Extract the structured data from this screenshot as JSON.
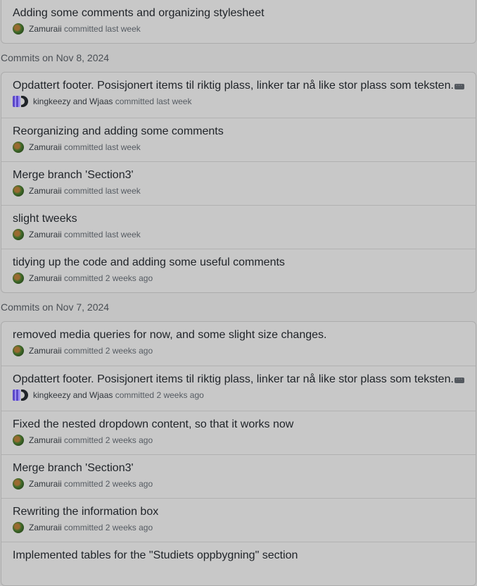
{
  "top_commit": {
    "title": "Adding some comments and organizing stylesheet",
    "author": "Zamuraii",
    "action": "committed",
    "time": "last week"
  },
  "groups": [
    {
      "header": "Commits on Nov 8, 2024",
      "commits": [
        {
          "title": "Opdattert footer. Posisjonert items til riktig plass, linker tar nå like stor plass som teksten.",
          "author": "kingkeezy and Wjaas",
          "action": "committed",
          "time": "last week",
          "pair": true,
          "ellipsis": "···"
        },
        {
          "title": "Reorganizing and adding some comments",
          "author": "Zamuraii",
          "action": "committed",
          "time": "last week"
        },
        {
          "title": "Merge branch 'Section3'",
          "author": "Zamuraii",
          "action": "committed",
          "time": "last week"
        },
        {
          "title": "slight tweeks",
          "author": "Zamuraii",
          "action": "committed",
          "time": "last week"
        },
        {
          "title": "tidying up the code and adding some useful comments",
          "author": "Zamuraii",
          "action": "committed",
          "time": "2 weeks ago"
        }
      ]
    },
    {
      "header": "Commits on Nov 7, 2024",
      "commits": [
        {
          "title": "removed media queries for now, and some slight size changes.",
          "author": "Zamuraii",
          "action": "committed",
          "time": "2 weeks ago"
        },
        {
          "title": "Opdattert footer. Posisjonert items til riktig plass, linker tar nå like stor plass som teksten.",
          "author": "kingkeezy and Wjaas",
          "action": "committed",
          "time": "2 weeks ago",
          "pair": true,
          "ellipsis": "···"
        },
        {
          "title": "Fixed the nested dropdown content, so that it works now",
          "author": "Zamuraii",
          "action": "committed",
          "time": "2 weeks ago"
        },
        {
          "title": "Merge branch 'Section3'",
          "author": "Zamuraii",
          "action": "committed",
          "time": "2 weeks ago"
        },
        {
          "title": "Rewriting the information box",
          "author": "Zamuraii",
          "action": "committed",
          "time": "2 weeks ago"
        },
        {
          "title": "Implemented tables for the \"Studiets oppbygning\" section",
          "author": "",
          "action": "",
          "time": ""
        }
      ]
    }
  ]
}
